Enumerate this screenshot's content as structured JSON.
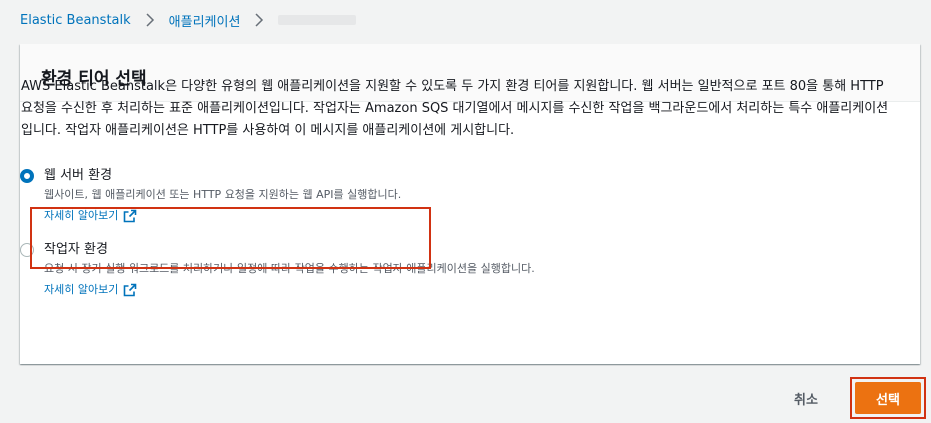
{
  "breadcrumb": {
    "items": [
      {
        "label": "Elastic Beanstalk"
      },
      {
        "label": "애플리케이션"
      }
    ]
  },
  "panel": {
    "title": "환경 티어 선택",
    "description": "AWS Elastic Beanstalk은 다양한 유형의 웹 애플리케이션을 지원할 수 있도록 두 가지 환경 티어를 지원합니다. 웹 서버는 일반적으로 포트 80을 통해 HTTP 요청을 수신한 후 처리하는 표준 애플리케이션입니다. 작업자는 Amazon SQS 대기열에서 메시지를 수신한 작업을 백그라운드에서 처리하는 특수 애플리케이션입니다. 작업자 애플리케이션은 HTTP를 사용하여 이 메시지를 애플리케이션에 게시합니다."
  },
  "options": [
    {
      "title": "웹 서버 환경",
      "description": "웹사이트, 웹 애플리케이션 또는 HTTP 요청을 지원하는 웹 API를 실행합니다.",
      "learn_more": "자세히 알아보기",
      "selected": true
    },
    {
      "title": "작업자 환경",
      "description": "요청 시 장기 실행 워크로드를 처리하거나 일정에 따라 작업을 수행하는 작업자 애플리케이션을 실행합니다.",
      "learn_more": "자세히 알아보기",
      "selected": false
    }
  ],
  "footer": {
    "cancel_label": "취소",
    "select_label": "선택"
  },
  "colors": {
    "link": "#0073bb",
    "primary_button": "#ec7211",
    "highlight": "#d13212"
  }
}
